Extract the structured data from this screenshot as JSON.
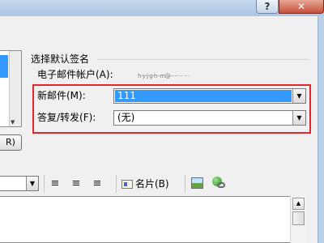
{
  "titlebar": {
    "help_label": "?",
    "close_label": "✕"
  },
  "left_panel": {
    "button_label": "R)"
  },
  "signature": {
    "group_title": "选择默认签名",
    "email_account_label": "电子邮件帐户(A):",
    "email_account_value": "h·y·j·g·h··m@······ ·· ·· ·",
    "new_message_label": "新邮件(M):",
    "new_message_value": "111",
    "reply_forward_label": "答复/转发(F):",
    "reply_forward_value": "(无)"
  },
  "toolbar": {
    "align_left_icon": "≡",
    "align_center_icon": "≡",
    "align_right_icon": "≡",
    "business_card_label": "名片(B)"
  },
  "colors": {
    "highlight": "#e0262e",
    "selection": "#3399ff"
  }
}
